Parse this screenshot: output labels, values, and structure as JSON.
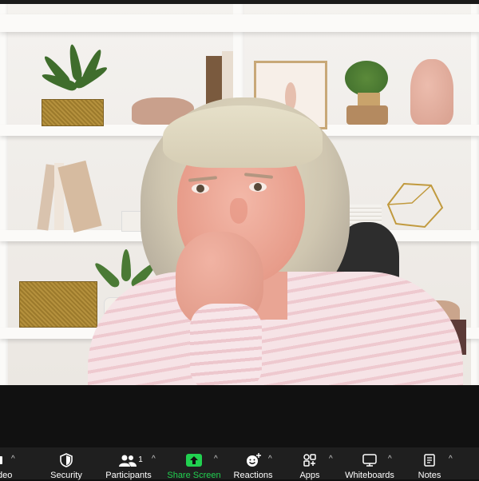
{
  "toolbar": {
    "items": [
      {
        "label": "ideo",
        "icon": "video-camera-icon"
      },
      {
        "label": "Security",
        "icon": "shield-icon"
      },
      {
        "label": "Participants",
        "icon": "participants-icon",
        "count": "1"
      },
      {
        "label": "Share Screen",
        "icon": "share-screen-icon"
      },
      {
        "label": "Reactions",
        "icon": "reactions-icon"
      },
      {
        "label": "Apps",
        "icon": "apps-icon"
      },
      {
        "label": "Whiteboards",
        "icon": "whiteboard-icon"
      },
      {
        "label": "Notes",
        "icon": "notes-icon"
      }
    ],
    "caret": "^"
  },
  "colors": {
    "toolbar_bg": "#1f1f1f",
    "share_accent": "#21d150",
    "stage_bg": "#111111"
  }
}
